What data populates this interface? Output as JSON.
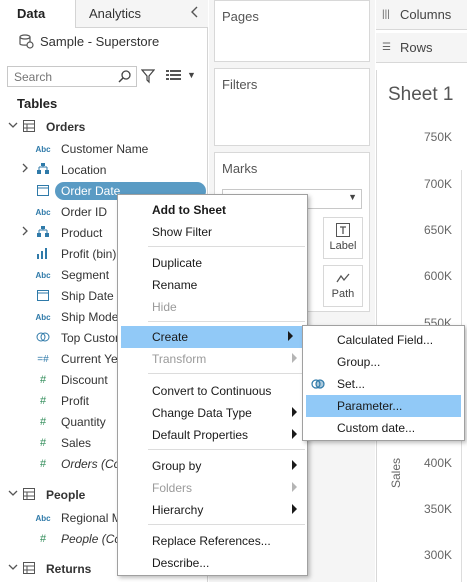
{
  "tabs": {
    "data": "Data",
    "analytics": "Analytics"
  },
  "datasource": "Sample - Superstore",
  "search": {
    "placeholder": "Search"
  },
  "tables_heading": "Tables",
  "orders": {
    "name": "Orders",
    "fields": [
      {
        "type": "Abc",
        "label": "Customer Name"
      },
      {
        "type": "hier",
        "label": "Location"
      },
      {
        "type": "date",
        "label": "Order Date"
      },
      {
        "type": "Abc",
        "label": "Order ID"
      },
      {
        "type": "hier",
        "label": "Product"
      },
      {
        "type": "bin",
        "label": "Profit (bin)"
      },
      {
        "type": "Abc",
        "label": "Segment"
      },
      {
        "type": "date",
        "label": "Ship Date"
      },
      {
        "type": "Abc",
        "label": "Ship Mode"
      },
      {
        "type": "set",
        "label": "Top Customers"
      },
      {
        "type": "num",
        "label": "Current Year"
      },
      {
        "type": "#",
        "label": "Discount"
      },
      {
        "type": "#",
        "label": "Profit"
      },
      {
        "type": "#",
        "label": "Quantity"
      },
      {
        "type": "#",
        "label": "Sales"
      },
      {
        "type": "#",
        "label": "Orders (Count)"
      }
    ]
  },
  "people": {
    "name": "People",
    "fields": [
      {
        "type": "Abc",
        "label": "Regional Manager"
      },
      {
        "type": "#",
        "label": "People (Count)"
      }
    ]
  },
  "returns": {
    "name": "Returns"
  },
  "shelves": {
    "pages": "Pages",
    "filters": "Filters",
    "marks": "Marks",
    "label_btn": "Label",
    "path_btn": "Path"
  },
  "viz": {
    "columns": "Columns",
    "rows": "Rows",
    "sheet_title": "Sheet 1",
    "ylabel": "Sales",
    "ticks": [
      "750K",
      "700K",
      "650K",
      "600K",
      "550K",
      "400K",
      "350K",
      "300K"
    ]
  },
  "context_menu": {
    "items": [
      "Add to Sheet",
      "Show Filter",
      "Duplicate",
      "Rename",
      "Hide",
      "Create",
      "Transform",
      "Convert to Continuous",
      "Change Data Type",
      "Default Properties",
      "Group by",
      "Folders",
      "Hierarchy",
      "Replace References...",
      "Describe..."
    ]
  },
  "create_submenu": {
    "items": [
      "Calculated Field...",
      "Group...",
      "Set...",
      "Parameter...",
      "Custom date..."
    ]
  },
  "colors": {
    "selected_pill": "#5a9bc4",
    "menu_highlight": "#91c9f7",
    "field_icon": "#2f7aa9"
  }
}
